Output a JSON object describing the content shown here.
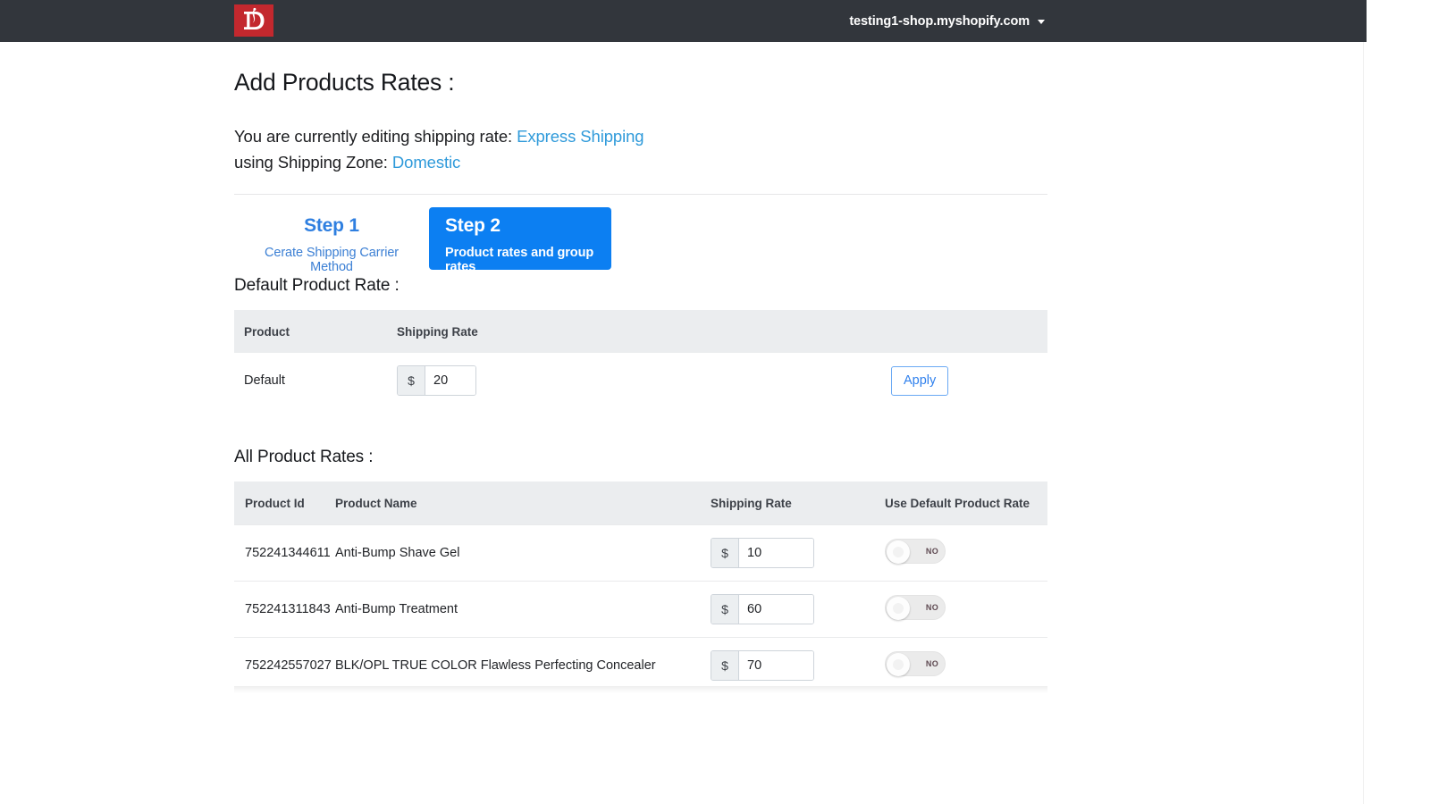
{
  "topbar": {
    "logo_icon": "letter-d-logo",
    "logo_color": "#c3282e",
    "shop_domain": "testing1-shop.myshopify.com",
    "caret_icon": "chevron-down-icon"
  },
  "page": {
    "title": "Add Products Rates :",
    "intro_prefix": "You are currently editing shipping rate:",
    "shipping_rate_link": "Express Shipping",
    "intro_zone_prefix": "using Shipping Zone:",
    "shipping_zone_link": "Domestic",
    "link_color": "#2f9ada"
  },
  "steps": [
    {
      "title": "Step 1",
      "subtitle": "Cerate Shipping Carrier Method",
      "active": false
    },
    {
      "title": "Step 2",
      "subtitle": "Product rates and group rates",
      "active": true,
      "active_color": "#0c7ff2"
    }
  ],
  "default_section": {
    "title": "Default Product Rate :",
    "columns": [
      "Product",
      "Shipping Rate",
      ""
    ],
    "row": {
      "product": "Default",
      "currency_symbol": "$",
      "rate": "20",
      "apply_label": "Apply"
    }
  },
  "all_section": {
    "title": "All Product Rates :",
    "columns": [
      "Product Id",
      "Product Name",
      "Shipping Rate",
      "Use Default Product Rate"
    ],
    "currency_symbol": "$",
    "rows": [
      {
        "product_id": "752241344611",
        "product_name": "Anti-Bump Shave Gel",
        "rate": "10",
        "use_default": "NO"
      },
      {
        "product_id": "752241311843",
        "product_name": "Anti-Bump Treatment",
        "rate": "60",
        "use_default": "NO"
      },
      {
        "product_id": "752242557027",
        "product_name": "BLK/OPL TRUE COLOR Flawless Perfecting Concealer",
        "rate": "70",
        "use_default": "NO"
      }
    ]
  }
}
